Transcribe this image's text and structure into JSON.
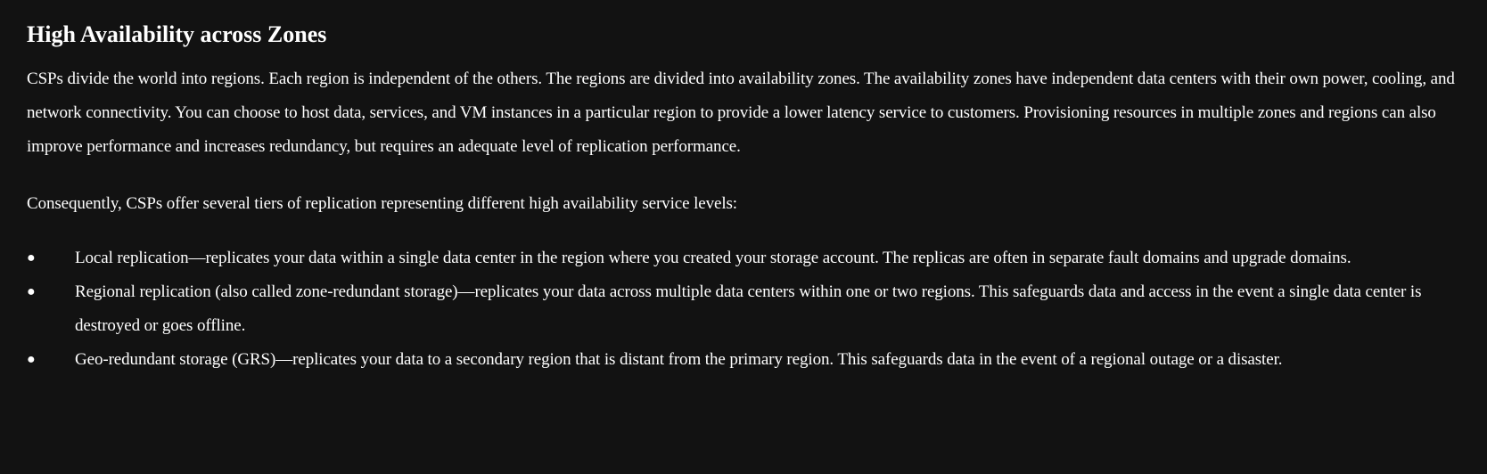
{
  "heading": "High Availability across Zones",
  "paragraphs": [
    "CSPs divide the world into regions. Each region is independent of the others. The regions are divided into availability zones. The availability zones have independent data centers with their own power, cooling, and network connectivity. You can choose to host data, services, and VM instances in a particular region to provide a lower latency service to customers. Provisioning resources in multiple zones and regions can also improve performance and increases redundancy, but requires an adequate level of replication performance.",
    "Consequently, CSPs offer several tiers of replication representing different high availability service levels:"
  ],
  "list": {
    "bullet": "●",
    "items": [
      "Local replication—replicates your data within a single data center in the region where you created your storage account. The replicas are often in separate fault domains and upgrade domains.",
      "Regional replication (also called zone-redundant storage)—replicates your data across multiple data centers within one or two regions. This safeguards data and access in the event a single data center is destroyed or goes offline.",
      "Geo-redundant storage (GRS)—replicates your data to a secondary region that is distant from the primary region. This safeguards data in the event of a regional outage or a disaster."
    ]
  }
}
